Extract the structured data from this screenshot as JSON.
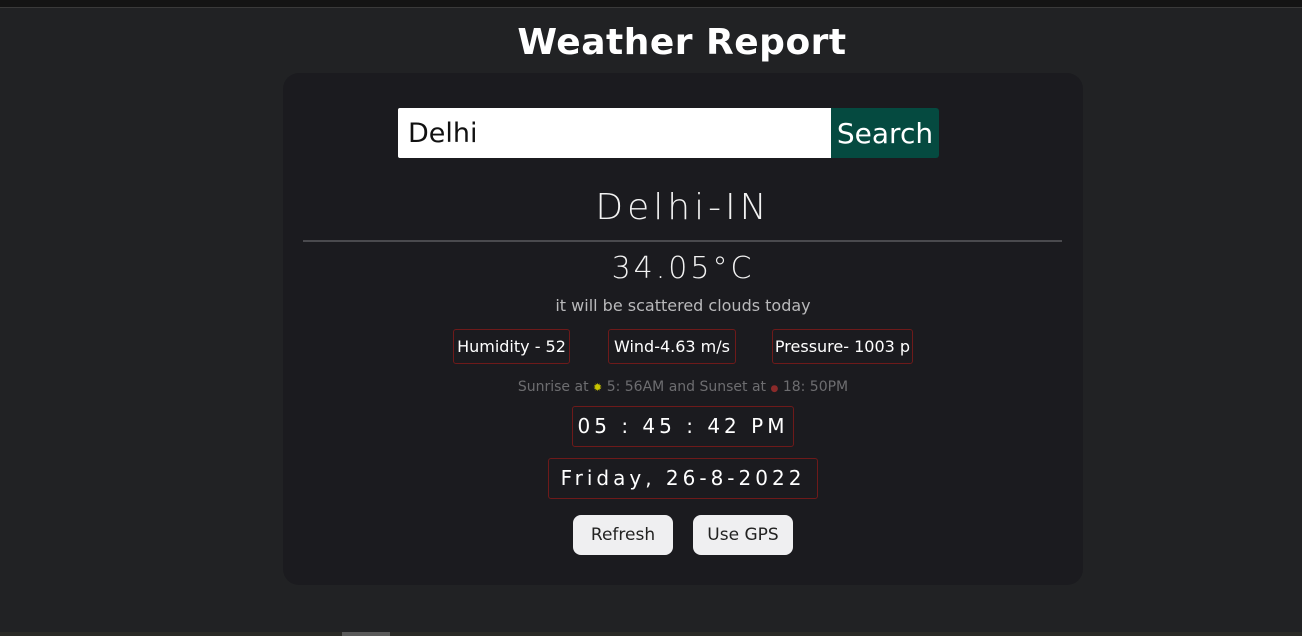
{
  "page": {
    "title": "Weather Report"
  },
  "search": {
    "value": "Delhi",
    "button_label": "Search"
  },
  "weather": {
    "location": "Delhi-IN",
    "temperature": "34.05°C",
    "description": "it will be scattered clouds today",
    "humidity": "Humidity - 52",
    "wind": "Wind-4.63 m/s",
    "pressure": "Pressure- 1003 p",
    "sunrise_prefix": "Sunrise at",
    "sunrise_time": "5: 56AM",
    "sunset_prefix": "and Sunset at",
    "sunset_time": "18: 50PM"
  },
  "clock": {
    "time": "05 : 45 : 42 PM",
    "date": "Friday, 26-8-2022"
  },
  "actions": {
    "refresh_label": "Refresh",
    "gps_label": "Use GPS"
  },
  "icons": {
    "sunrise": "sun-icon",
    "sunset": "sunset-icon"
  },
  "colors": {
    "background": "#212224",
    "card": "#1b1b1f",
    "search_button": "#054a40",
    "box_border": "#6e1a1a",
    "sunrise_icon": "#c8c400",
    "sunset_icon": "#8a2a2a"
  }
}
